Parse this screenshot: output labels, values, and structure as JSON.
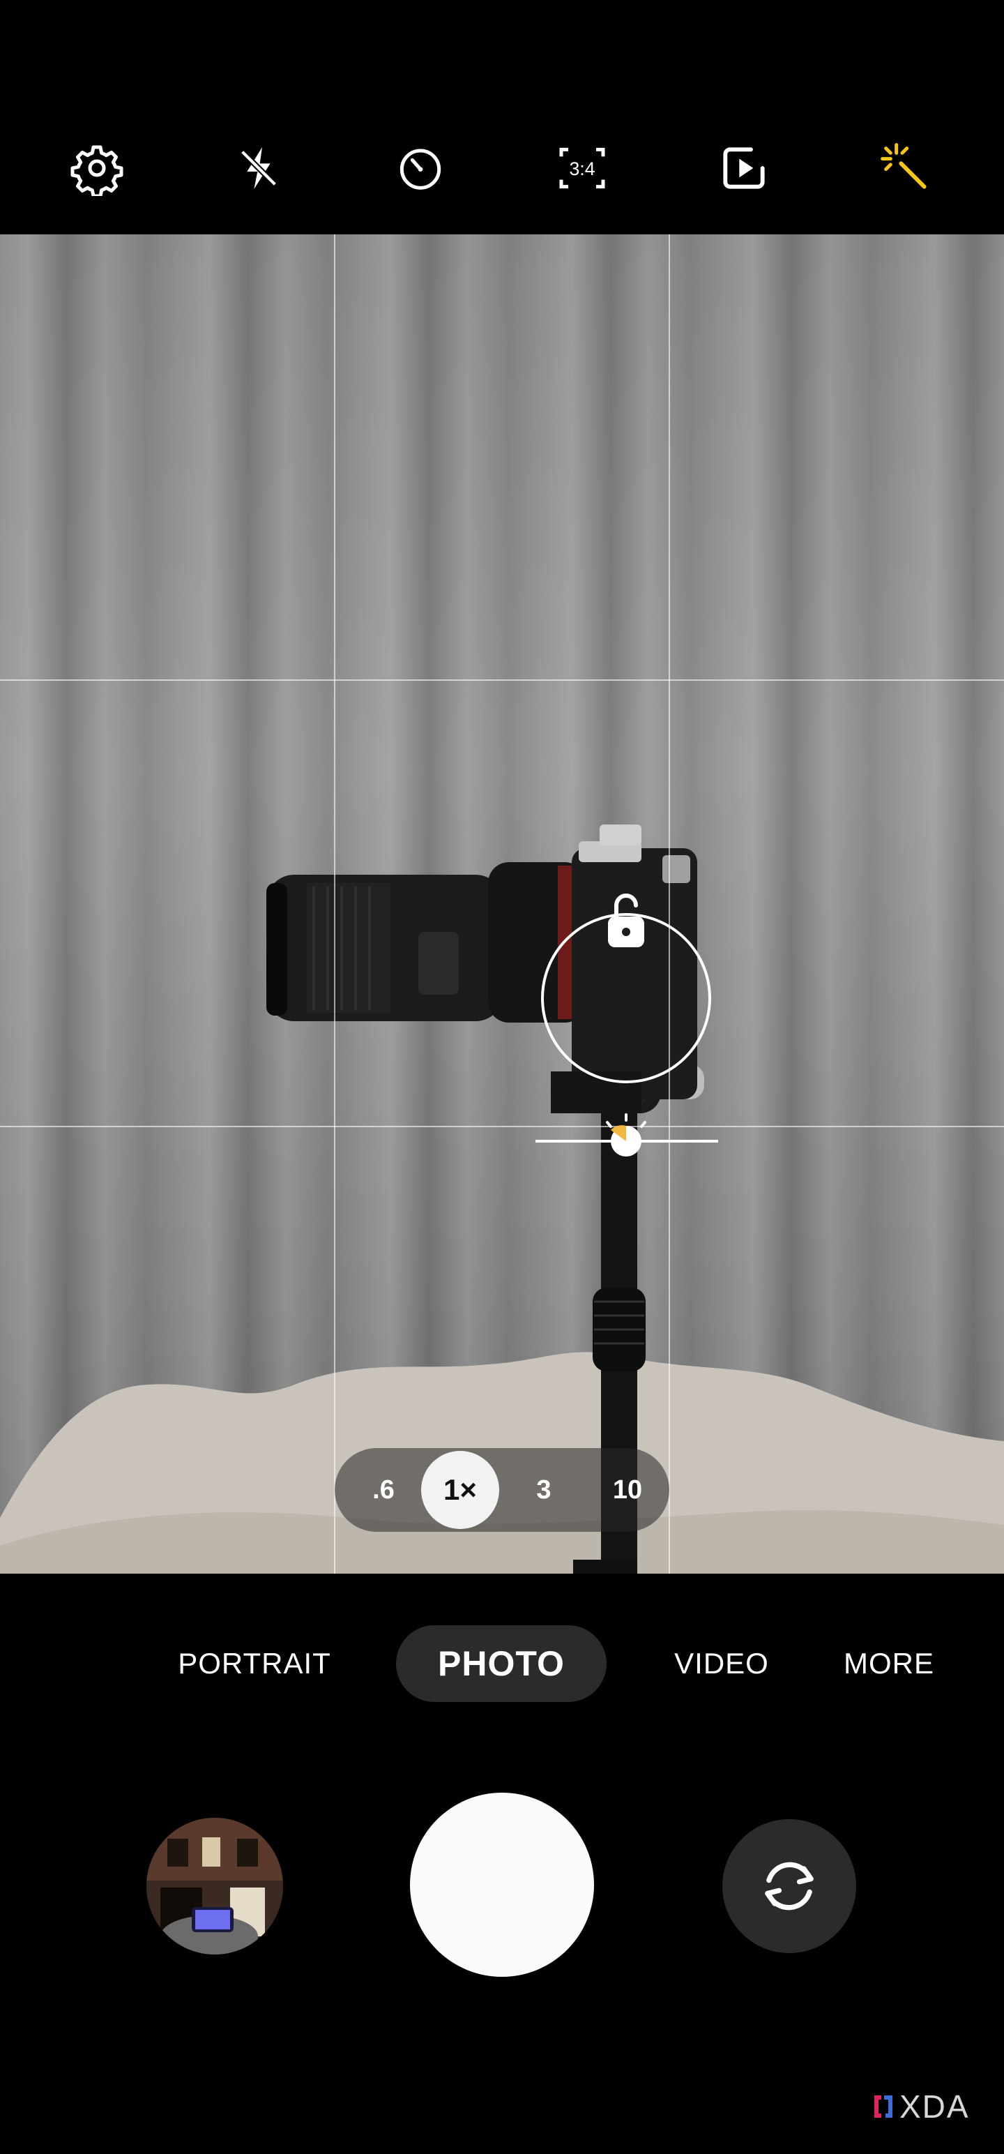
{
  "toolbar": {
    "icons": [
      "gear-icon",
      "flash-off-icon",
      "timer-icon",
      "aspect-ratio-icon",
      "motion-photo-icon",
      "filters-icon"
    ],
    "aspect_ratio_label": "3:4",
    "accent_color": "#f5c518"
  },
  "zoom": {
    "options": [
      ".6",
      "1×",
      "3",
      "10"
    ],
    "selected": "1×"
  },
  "modes": {
    "items": [
      "PORTRAIT",
      "PHOTO",
      "VIDEO",
      "MORE"
    ],
    "selected": "PHOTO"
  },
  "watermark": {
    "text": "XDA"
  }
}
